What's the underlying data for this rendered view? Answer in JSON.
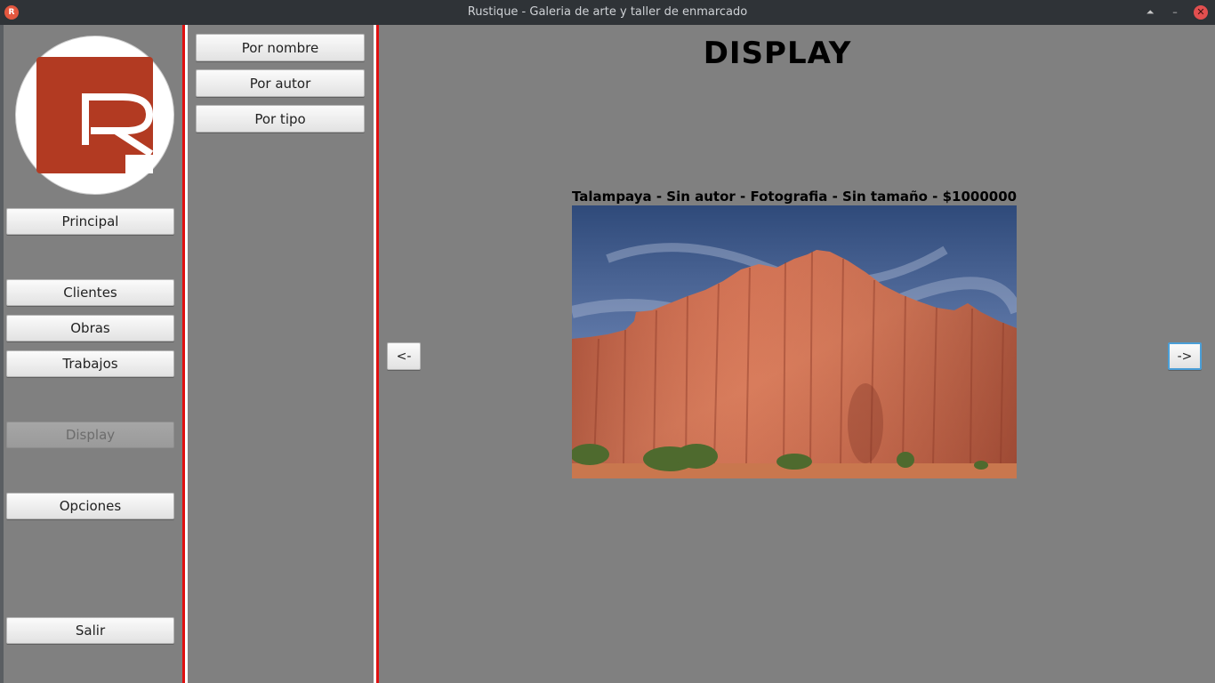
{
  "window": {
    "title": "Rustique - Galeria de arte y taller de enmarcado",
    "app_icon": "R",
    "keep_above_icon": "⏶",
    "minimize_icon": "–",
    "close_icon": "✕"
  },
  "sidebar": {
    "logo_letter": "R",
    "logo_color": "#b23a22",
    "items": [
      {
        "label": "Principal",
        "enabled": true
      },
      {
        "label": "Clientes",
        "enabled": true
      },
      {
        "label": "Obras",
        "enabled": true
      },
      {
        "label": "Trabajos",
        "enabled": true
      },
      {
        "label": "Display",
        "enabled": false
      },
      {
        "label": "Opciones",
        "enabled": true
      },
      {
        "label": "Salir",
        "enabled": true
      }
    ]
  },
  "sort_panel": {
    "buttons": [
      "Por nombre",
      "Por autor",
      "Por tipo"
    ]
  },
  "main": {
    "title": "DISPLAY",
    "caption": "Talampaya - Sin autor - Fotografia - Sin tamaño - $1000000",
    "prev_label": "<-",
    "next_label": "->"
  },
  "colors": {
    "background": "#808080",
    "separator_red": "#e01010",
    "focus_blue": "#4a9fd8"
  }
}
